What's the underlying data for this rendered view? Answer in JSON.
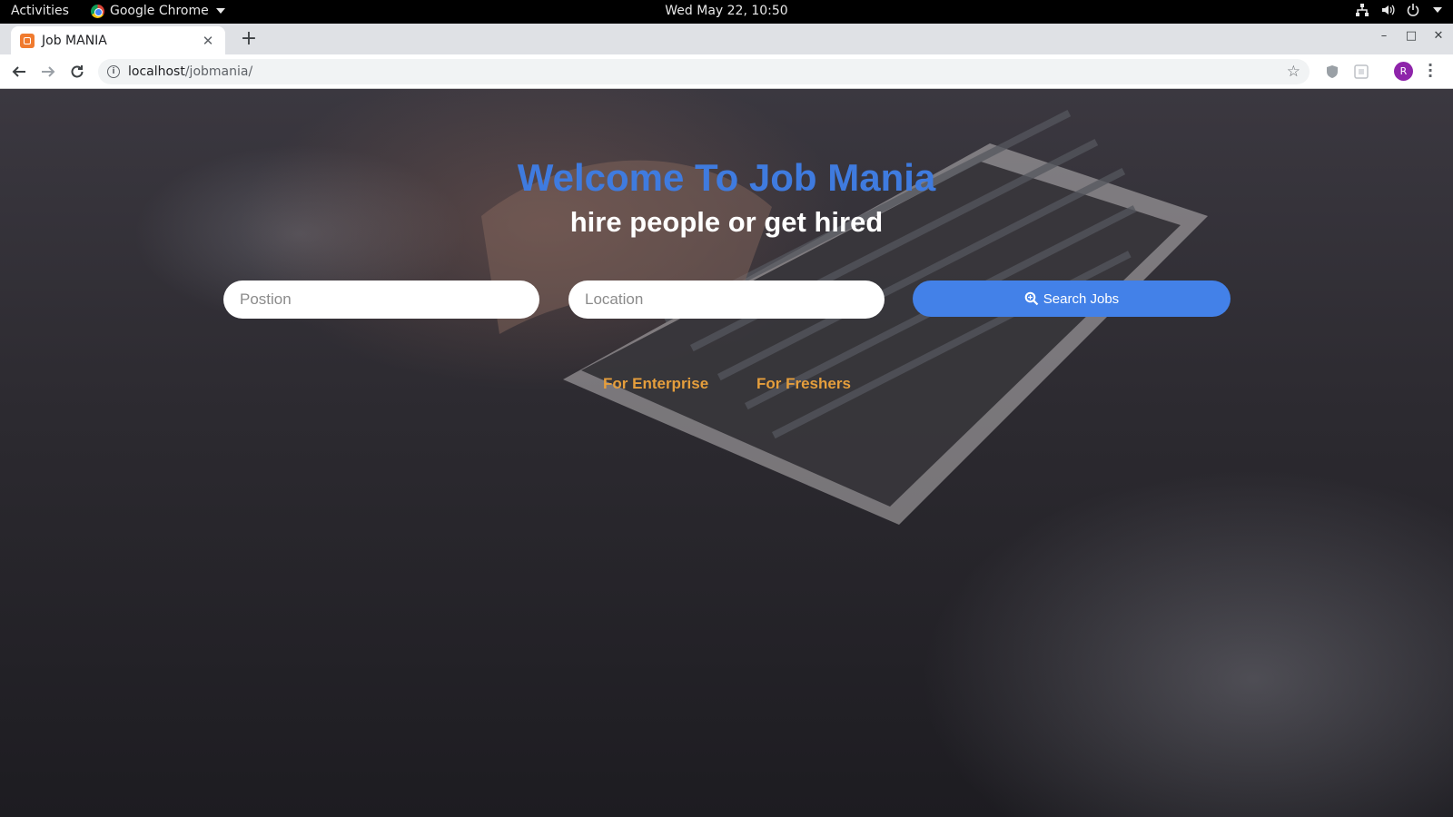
{
  "system_bar": {
    "activities": "Activities",
    "app_name": "Google Chrome",
    "clock": "Wed May 22, 10:50"
  },
  "browser": {
    "tab_title": "Job MANIA",
    "url_host": "localhost",
    "url_path": "/jobmania/",
    "profile_initial": "R"
  },
  "hero": {
    "title": "Welcome To Job Mania",
    "subtitle": "hire people or get hired"
  },
  "search": {
    "position_placeholder": "Postion",
    "location_placeholder": "Location",
    "button_label": "Search Jobs"
  },
  "links": {
    "enterprise": "For Enterprise",
    "freshers": "For Freshers"
  },
  "colors": {
    "title": "#3f7bdf",
    "button": "#4381e8",
    "links": "#e59e3c"
  }
}
